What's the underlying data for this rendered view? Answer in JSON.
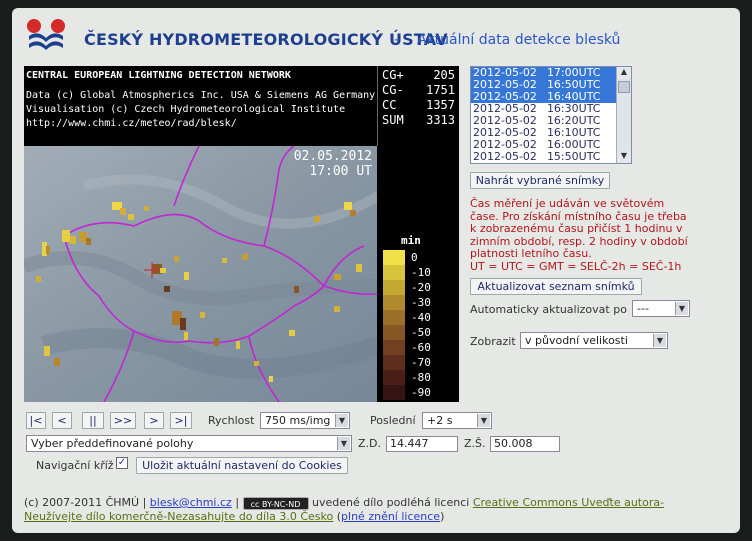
{
  "header": {
    "brand": "ČESKÝ HYDROMETEOROLOGICKÝ ÚSTAV",
    "separator": "-",
    "subtitle": "Aktuální data detekce blesků"
  },
  "info": {
    "network": "CENTRAL EUROPEAN LIGHTNING DETECTION NETWORK",
    "line1": "Data (c) Global Atmospherics Inc. USA & Siemens AG Germany",
    "line2": "Visualisation (c) Czech Hydrometeorological Institute",
    "line3": "http://www.chmi.cz/meteo/rad/blesk/"
  },
  "counts": [
    {
      "label": "CG+",
      "value": "205"
    },
    {
      "label": "CG-",
      "value": "1751"
    },
    {
      "label": "CC",
      "value": "1357"
    },
    {
      "label": "SUM",
      "value": "3313"
    }
  ],
  "map": {
    "date": "02.05.2012",
    "time": "17:00 UT"
  },
  "legend": {
    "title": "min",
    "items": [
      {
        "label": "0",
        "color": "#f2e04a"
      },
      {
        "label": "-10",
        "color": "#d8c43a"
      },
      {
        "label": "-20",
        "color": "#c3a832"
      },
      {
        "label": "-30",
        "color": "#b08a2c"
      },
      {
        "label": "-40",
        "color": "#9c6e28"
      },
      {
        "label": "-50",
        "color": "#885524"
      },
      {
        "label": "-60",
        "color": "#733f20"
      },
      {
        "label": "-70",
        "color": "#5e2d1c"
      },
      {
        "label": "-80",
        "color": "#4a1f18"
      },
      {
        "label": "-90",
        "color": "#361414"
      }
    ]
  },
  "timelist": [
    {
      "date": "2012-05-02",
      "time": "17:00UTC",
      "selected": true
    },
    {
      "date": "2012-05-02",
      "time": "16:50UTC",
      "selected": true
    },
    {
      "date": "2012-05-02",
      "time": "16:40UTC",
      "selected": true
    },
    {
      "date": "2012-05-02",
      "time": "16:30UTC",
      "selected": false
    },
    {
      "date": "2012-05-02",
      "time": "16:20UTC",
      "selected": false
    },
    {
      "date": "2012-05-02",
      "time": "16:10UTC",
      "selected": false
    },
    {
      "date": "2012-05-02",
      "time": "16:00UTC",
      "selected": false
    },
    {
      "date": "2012-05-02",
      "time": "15:50UTC",
      "selected": false
    }
  ],
  "buttons": {
    "load_selected": "Nahrát vybrané snímky",
    "refresh_list": "Aktualizovat seznam snímků",
    "save_cookies": "Uložit aktuální nastavení do Cookies"
  },
  "note": [
    "Čas měření je udáván ve světovém",
    "čase. Pro získání místního času je třeba",
    "k zobrazenému času přičíst 1 hodinu v",
    "zimním období, resp. 2 hodiny v období",
    "platnosti letního času.",
    "UT = UTC = GMT = SELČ-2h = SEČ-1h"
  ],
  "auto_update": {
    "label": "Automaticky aktualizovat po",
    "value": "---"
  },
  "display": {
    "label": "Zobrazit",
    "value": "v původní velikosti"
  },
  "nav": {
    "first": "|<",
    "prev": "<",
    "pause": "||",
    "fwd": ">>",
    "next": ">",
    "last": ">|",
    "speed_label": "Rychlost",
    "speed_value": "750 ms/img",
    "last_label": "Poslední",
    "last_value": "+2 s"
  },
  "position": {
    "select": "Vyber předdefinované polohy",
    "lon_label": "Z.D.",
    "lon_value": "14.447",
    "lat_label": "Z.Š.",
    "lat_value": "50.008"
  },
  "cross": {
    "label": "Navigační kříž",
    "checked": true
  },
  "footer": {
    "copyright": "(c) 2007-2011 ČHMÚ |",
    "email": "blesk@chmi.cz",
    "pipe": "|",
    "cc_badge": "cc BY-NC-ND",
    "licence_text": "uvedené dílo podléhá licenci",
    "licence_link1": "Creative Commons Uveďte autora-",
    "licence_link2": "Neužívejte dílo komerčně-Nezasahujte do díla 3.0 Česko",
    "full_open": "(",
    "full_link": "plné znění licence",
    "full_close": ")"
  }
}
